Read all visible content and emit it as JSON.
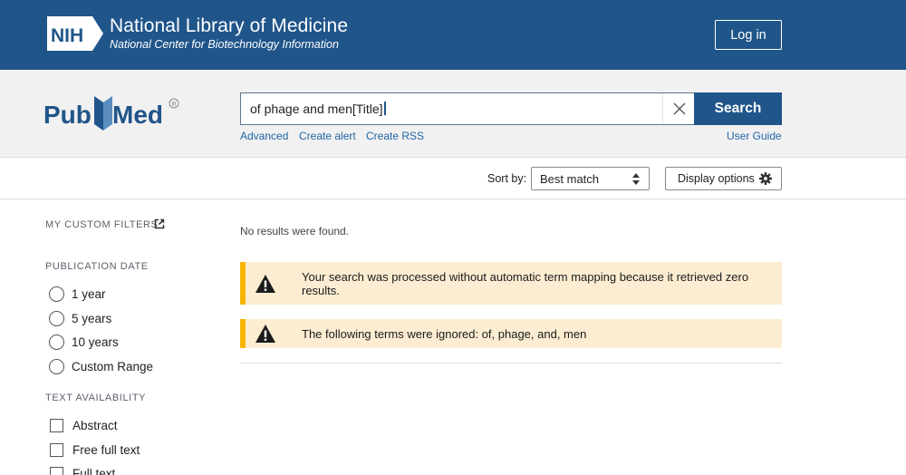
{
  "header": {
    "logo_text": "NIH",
    "title": "National Library of Medicine",
    "subtitle": "National Center for Biotechnology Information",
    "login_label": "Log in"
  },
  "search": {
    "brand_text": "PubMed",
    "value": "of phage and men[Title]",
    "button_label": "Search",
    "links": {
      "advanced": "Advanced",
      "create_alert": "Create alert",
      "create_rss": "Create RSS",
      "user_guide": "User Guide"
    }
  },
  "toolbar": {
    "sort_label": "Sort by:",
    "sort_value": "Best match",
    "display_options_label": "Display options"
  },
  "sidebar": {
    "custom_filters_heading": "MY CUSTOM FILTERS",
    "publication_date_heading": "PUBLICATION DATE",
    "date_options": [
      "1 year",
      "5 years",
      "10 years",
      "Custom Range"
    ],
    "text_availability_heading": "TEXT AVAILABILITY",
    "text_options": [
      "Abstract",
      "Free full text",
      "Full text"
    ]
  },
  "results": {
    "no_results_text": "No results were found.",
    "alerts": [
      "Your search was processed without automatic term mapping because it retrieved zero results.",
      "The following terms were ignored: of, phage, and, men"
    ]
  },
  "colors": {
    "nih_blue": "#20558a",
    "alert_bg": "#fcedd2",
    "alert_border": "#f7b500",
    "link": "#2166a5"
  },
  "icons": [
    "nih-logo-icon",
    "pubmed-logo-icon",
    "clear-icon",
    "sort-arrows-icon",
    "gear-icon",
    "external-link-icon",
    "warning-icon"
  ]
}
